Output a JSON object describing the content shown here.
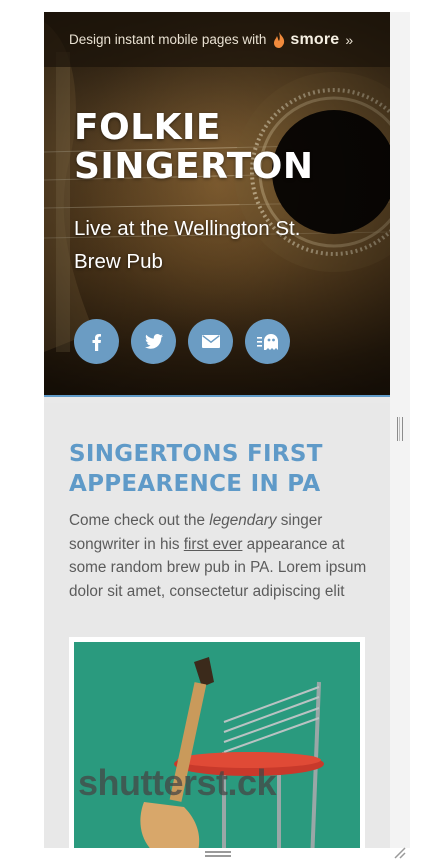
{
  "promo": {
    "text": "Design instant mobile pages with",
    "brand": "smore",
    "arrow": "»"
  },
  "hero": {
    "title": "FOLKIE SINGERTON",
    "subtitle": "Live at the Wellington St. Brew Pub",
    "social": [
      {
        "name": "facebook",
        "icon": "facebook-icon"
      },
      {
        "name": "twitter",
        "icon": "twitter-icon"
      },
      {
        "name": "email",
        "icon": "mail-icon"
      },
      {
        "name": "ghost",
        "icon": "ghost-icon"
      }
    ],
    "accent": "#5f9ac8"
  },
  "section": {
    "title": "SINGERTONS FIRST APPEARENCE IN PA",
    "body_1": "Come check out the ",
    "body_em": "legendary",
    "body_2": " singer songwriter in his ",
    "body_link": "first ever",
    "body_3": " appearance at some random brew pub in PA. Lorem ipsum dolor sit amet, consectetur adipiscing elit"
  },
  "photo": {
    "watermark": "shutterst.ck"
  },
  "colors": {
    "accent": "#5f9ac8",
    "social_bg": "#6b9cc3",
    "content_bg": "#e8e8e8",
    "photo_bg": "#2a9a7e"
  }
}
